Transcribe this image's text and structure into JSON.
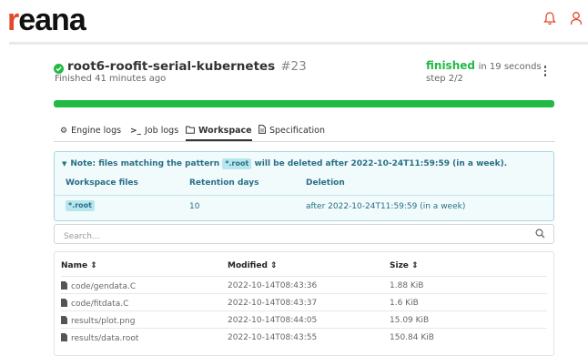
{
  "header": {
    "logo_first": "r",
    "logo_rest": "eana",
    "bell_icon": "bell-icon",
    "user_icon": "user-icon"
  },
  "workflow": {
    "name": "root6-roofit-serial-kubernetes",
    "run_number": "#23",
    "finished_ago": "Finished 41 minutes ago",
    "status": "finished",
    "duration": "in 19 seconds",
    "step": "step 2/2",
    "progress_fraction": 1.0,
    "colors": {
      "success": "#21ba45",
      "logo_red": "#e3492d",
      "note_text": "#276f86"
    }
  },
  "tabs": [
    {
      "label": "Engine logs",
      "icon": "gears-icon"
    },
    {
      "label": "Job logs",
      "icon": "terminal-icon"
    },
    {
      "label": "Workspace",
      "icon": "folder-icon",
      "active": true
    },
    {
      "label": "Specification",
      "icon": "file-icon"
    }
  ],
  "retention": {
    "note_prefix": "Note: files matching the pattern",
    "pattern": "*.root",
    "note_suffix": "will be deleted after 2022-10-24T11:59:59 (in a week).",
    "headers": {
      "files": "Workspace files",
      "days": "Retention days",
      "deletion": "Deletion"
    },
    "row": {
      "files": "*.root",
      "days": "10",
      "deletion": "after 2022-10-24T11:59:59 (in a week)"
    }
  },
  "search": {
    "placeholder": "Search...",
    "value": ""
  },
  "files": {
    "headers": {
      "name": "Name",
      "modified": "Modified",
      "size": "Size"
    },
    "sort_glyph": "⇕",
    "rows": [
      {
        "name": "code/gendata.C",
        "modified": "2022-10-14T08:43:36",
        "size": "1.88 KiB"
      },
      {
        "name": "code/fitdata.C",
        "modified": "2022-10-14T08:43:37",
        "size": "1.6 KiB"
      },
      {
        "name": "results/plot.png",
        "modified": "2022-10-14T08:44:05",
        "size": "15.09 KiB"
      },
      {
        "name": "results/data.root",
        "modified": "2022-10-14T08:43:55",
        "size": "150.84 KiB"
      }
    ]
  }
}
